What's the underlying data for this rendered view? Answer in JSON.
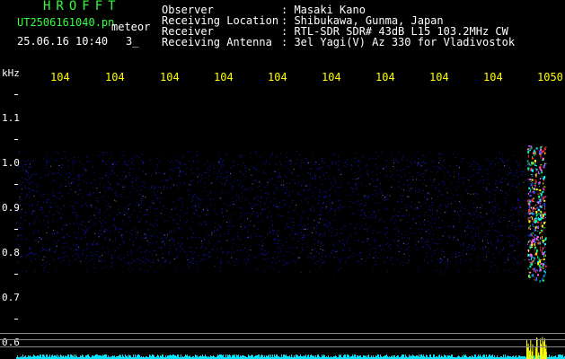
{
  "header": {
    "title": "HROFFT",
    "file_name": "UT2506161040.pn",
    "meteor_label": "meteor",
    "date_time": "25.06.16 10:40",
    "count": "3_"
  },
  "info": [
    {
      "label": "Observer",
      "value": ": Masaki Kano"
    },
    {
      "label": "Receiving Location",
      "value": ": Shibukawa, Gunma, Japan"
    },
    {
      "label": "Receiver",
      "value": ": RTL-SDR SDR# 43dB L15 103.2MHz CW"
    },
    {
      "label": "Receiving Antenna",
      "value": ": 3el Yagi(V) Az 330 for Vladivostok"
    }
  ],
  "axis": {
    "unit": "kHz",
    "freq_ticks": [
      "104",
      "104",
      "104",
      "104",
      "104",
      "104",
      "104",
      "104",
      "104",
      "1050"
    ],
    "y_ticks": [
      "1.1",
      "1.0",
      "0.9",
      "0.8",
      "0.7",
      "0.6"
    ]
  },
  "colors": {
    "header_green": "#32ff3c",
    "tick_yellow": "#ffff00",
    "noise_blue": "#1a1aff",
    "baseline_cyan": "#00e5ff"
  }
}
